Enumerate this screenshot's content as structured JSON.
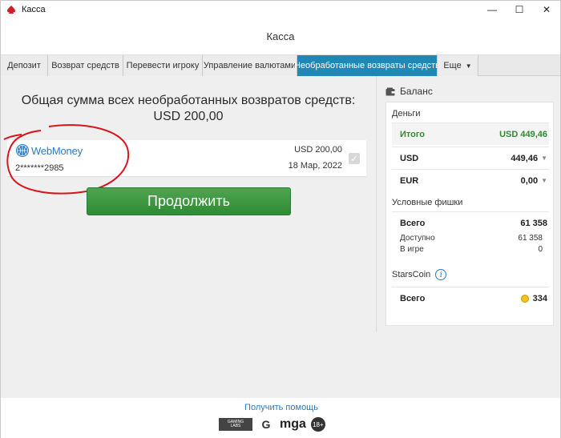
{
  "window": {
    "title": "Касса",
    "controls": {
      "minimize": "—",
      "maximize": "☐",
      "close": "✕"
    }
  },
  "header": {
    "title": "Касса"
  },
  "tabs": [
    {
      "label": "Депозит",
      "active": false
    },
    {
      "label": "Возврат средств",
      "active": false
    },
    {
      "label": "Перевести игроку",
      "active": false
    },
    {
      "label": "Управление валютами",
      "active": false
    },
    {
      "label": "Необработанные возвраты средств",
      "active": true
    },
    {
      "label": "Еще",
      "active": false
    }
  ],
  "main": {
    "total_title": "Общая сумма всех необработанных возвратов средств:",
    "total_amount": "USD 200,00",
    "refund": {
      "method": "WebMoney",
      "account": "2*******2985",
      "amount": "USD 200,00",
      "date": "18 Мар, 2022"
    },
    "continue_label": "Продолжить"
  },
  "balance": {
    "title": "Баланс",
    "money_label": "Деньги",
    "total_label": "Итого",
    "total_value": "USD 449,46",
    "usd_label": "USD",
    "usd_value": "449,46",
    "eur_label": "EUR",
    "eur_value": "0,00",
    "chips_label": "Условные фишки",
    "chips_total_label": "Всего",
    "chips_total_value": "61 358",
    "chips_available_label": "Доступно",
    "chips_available_value": "61 358",
    "chips_ingame_label": "В игре",
    "chips_ingame_value": "0",
    "starscoin_label": "StarsCoin",
    "starscoin_total_label": "Всего",
    "starscoin_total_value": "334"
  },
  "footer": {
    "help_label": "Получить помощь",
    "badge_mga": "mga",
    "badge_18": "18+"
  },
  "colors": {
    "accent": "#1e88b8",
    "button_green": "#3a963e",
    "total_green": "#2f8a34",
    "link_blue": "#2a7bc2",
    "annotation_red": "#d8151b"
  }
}
